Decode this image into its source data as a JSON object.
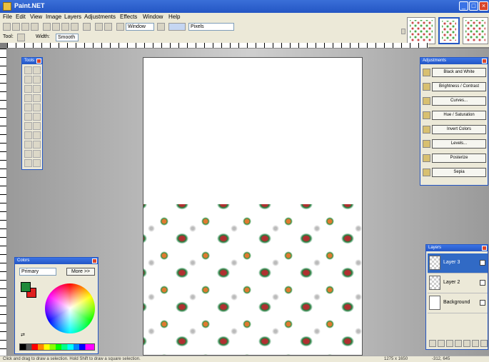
{
  "window": {
    "title": "Paint.NET",
    "minimize": "_",
    "maximize": "□",
    "close": "×"
  },
  "menu": [
    "File",
    "Edit",
    "View",
    "Image",
    "Layers",
    "Adjustments",
    "Effects",
    "Window",
    "Help"
  ],
  "toolbar": {
    "zoom_value": "Window",
    "units_value": "Pixels"
  },
  "toolbar2": {
    "tool_label": "Tool:",
    "brush_width": "Width:",
    "brush_value": "Smooth"
  },
  "panels": {
    "tools": {
      "title": "Tools"
    },
    "adjustments": {
      "title": "Adjustments",
      "items": [
        "Black and White",
        "Brightness / Contrast",
        "Curves...",
        "Hue / Saturation",
        "Invert Colors",
        "Levels...",
        "Posterize",
        "Sepia"
      ]
    },
    "colors": {
      "title": "Colors",
      "mode": "Primary",
      "more_button": "More >>"
    },
    "layers": {
      "title": "Layers",
      "items": [
        "Layer 3",
        "Layer 2",
        "Background"
      ]
    }
  },
  "statusbar": {
    "text": "Click and drag to draw a selection. Hold Shift to draw a square selection.",
    "size": "1275 x 1650",
    "coords": "-312, 645"
  },
  "colors_used": {
    "primary": "#1f8a3a",
    "secondary": "#e02020",
    "accent": "#2456c4"
  }
}
